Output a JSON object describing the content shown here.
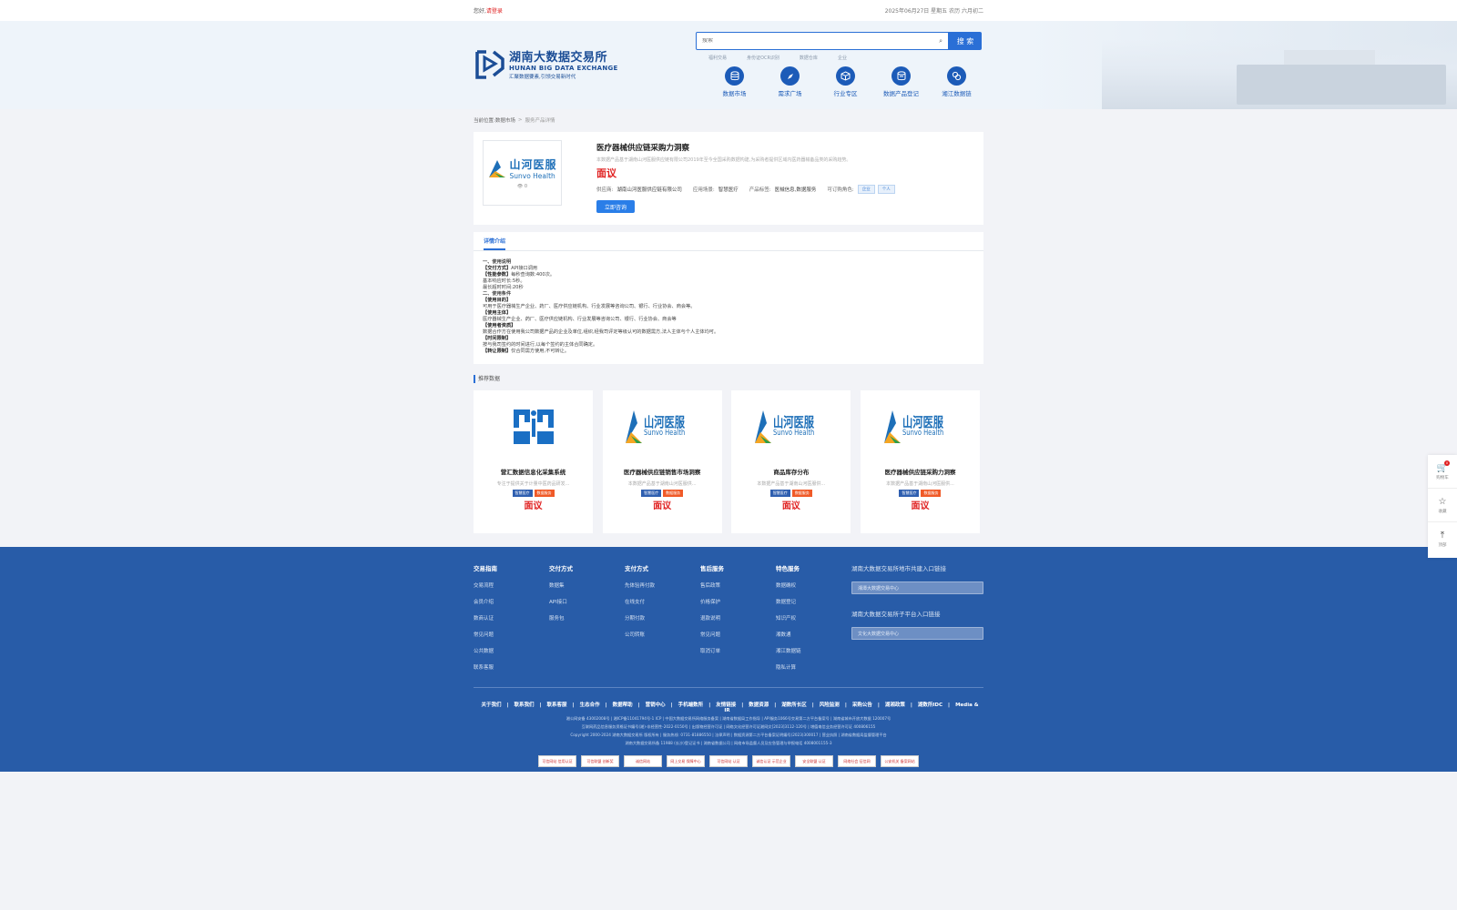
{
  "topbar": {
    "greeting": "您好,",
    "login_link": "请登录",
    "date": "2025年06月27日 星期五 农历 六月初二"
  },
  "header": {
    "logo_cn": "湖南大数据交易所",
    "logo_en": "HUNAN BIG DATA EXCHANGE",
    "logo_slogan": "汇聚数据要素,引领交易新时代",
    "search_placeholder": "搜索",
    "search_button": "搜 索",
    "hot_words": [
      "福利交易",
      "身份证OCR识别",
      "数据仓库",
      "企业"
    ],
    "nav": [
      {
        "label": "数据市场",
        "icon": "database-icon"
      },
      {
        "label": "需求广场",
        "icon": "compass-icon"
      },
      {
        "label": "行业专区",
        "icon": "cube-icon"
      },
      {
        "label": "数据产品登记",
        "icon": "register-icon"
      },
      {
        "label": "湘江数据链",
        "icon": "link-icon"
      }
    ]
  },
  "breadcrumb": {
    "prefix": "当前位置:",
    "level1": "数据市场",
    "sep": ">",
    "current": "服务产品详情"
  },
  "product": {
    "logo_cn": "山河医服",
    "logo_en": "Sunvo Health",
    "view_count": "0",
    "title": "医疗器械供应链采购力洞察",
    "desc": "本数据产品基于湖南山河医服供应链有限公司2019年至今全国采购数据构建,为采购者提供区域内医药器械备品类的采购趋势。",
    "price": "面议",
    "supplier_label": "供应商:",
    "supplier": "湖南山河医服供应链有限公司",
    "scene_label": "应用场景:",
    "scene": "智慧医疗",
    "tag_label": "产品标签:",
    "tag": "医械信息,数据服务",
    "role_label": "可订购角色:",
    "roles": [
      "企业",
      "个人"
    ],
    "consult_button": "立即咨询"
  },
  "detail": {
    "tab": "详情介绍",
    "lines": [
      {
        "b": "",
        "t": "一、使用说明"
      },
      {
        "b": "【交付方式】",
        "t": "API接口调用"
      },
      {
        "b": "【性能参数】",
        "t": "每秒查询数:400次。"
      },
      {
        "b": "",
        "t": "基本响应时长:5秒。"
      },
      {
        "b": "",
        "t": "最长超时时间:20秒"
      },
      {
        "b": "",
        "t": "二、使用条件"
      },
      {
        "b": "【使用目的】",
        "t": ""
      },
      {
        "b": "",
        "t": "可用于医疗器械生产企业、药厂、医疗供应链机构、行业发展等咨询公司、银行、行业协会、商会等。"
      },
      {
        "b": "【使用主体】",
        "t": ""
      },
      {
        "b": "",
        "t": "医疗器械生产企业、药厂、医疗供应链机构、行业发展等咨询公司、银行、行业协会、商会等"
      },
      {
        "b": "【使用者资质】",
        "t": ""
      },
      {
        "b": "",
        "t": "数据合作方在使用我公司数据产品的企业及单位,组织,经我司评定等级认可的数据需方,法人主体与个人主体均可。"
      },
      {
        "b": "【时间限制】",
        "t": ""
      },
      {
        "b": "",
        "t": "按与我司签约的时间进行,以每个签约的主体合同确定。"
      },
      {
        "b": "【转让限制】",
        "t": "仅合同需方使用,不可转让。"
      }
    ]
  },
  "recommend": {
    "title": "推荐数据",
    "items": [
      {
        "name": "营汇数据信息化采集系统",
        "desc": "专注于提供关于计量中医药品研发...",
        "tag1": "智慧医疗",
        "tag2": "数据服务",
        "price": "面议",
        "logo": "yinghui"
      },
      {
        "name": "医疗器械供应链销售市场洞察",
        "desc": "本数据产品基于湖南山河医服供...",
        "tag1": "智慧医疗",
        "tag2": "数据服务",
        "price": "面议",
        "logo": "sunvo"
      },
      {
        "name": "商品库存分布",
        "desc": "本数据产品基于湖南山河医服供...",
        "tag1": "智慧医疗",
        "tag2": "数据服务",
        "price": "面议",
        "logo": "sunvo"
      },
      {
        "name": "医疗器械供应链采购力洞察",
        "desc": "本数据产品基于湖南山河医服供...",
        "tag1": "智慧医疗",
        "tag2": "数据服务",
        "price": "面议",
        "logo": "sunvo"
      }
    ]
  },
  "footer": {
    "cols": [
      {
        "h": "交易指南",
        "items": [
          "交易流程",
          "会员介绍",
          "数商认证",
          "常见问题",
          "公共数据",
          "联系客服"
        ]
      },
      {
        "h": "交付方式",
        "items": [
          "数据集",
          "API接口",
          "服务包"
        ]
      },
      {
        "h": "支付方式",
        "items": [
          "先体验再付款",
          "在线支付",
          "分期付款",
          "公司转账"
        ]
      },
      {
        "h": "售后服务",
        "items": [
          "售后政策",
          "价格保护",
          "退款说明",
          "常见问题",
          "取消订单"
        ]
      },
      {
        "h": "特色服务",
        "items": [
          "数据确权",
          "数据登记",
          "知识产权",
          "湘数通",
          "湘江数据链",
          "隐私计算"
        ]
      }
    ],
    "entry1_label": "湖南大数据交易所地市共建入口链接",
    "entry1_select": "湘潭大数据交易中心",
    "entry2_label": "湖南大数据交易所子平台入口链接",
    "entry2_select": "文化大数据交易中心",
    "links": [
      "关于我们",
      "联系我们",
      "联系客服",
      "生态合作",
      "数据帮助",
      "营销中心",
      "手机端数所",
      "友情链接",
      "数据资源",
      "湖数所长区",
      "风险监测",
      "采购公告",
      "湖湘政策",
      "湖数所IDC",
      "Media & IR"
    ],
    "small1": "湘公网安备 43002008号 | 湘ICP备11041794号-1 ICP | 中国大数据交易所网络服务备案 | 湖南省数据局工作指导 | API服务1066号交易第二方平台备案号 | 湖南省城市开放大数据 120007号",
    "small2": "互联网药品信息服务资格证书编号(湘)-非经营性-2022-0150号 | 出版物经营许可证 | 网络文化经营许可证湘网文[2023]3112-120号 | 增值电信业务经营许可证 400806155",
    "small3": "Copyright 2000-2024 湖南大数据交易所 版权所有 | 服务热线: 0731-81886550 | 法律声明 | 数据资源第二方平台备案证明编号(2023)300017 | 营业执照 | 湖南省数据局监督管理平台",
    "small4": "湖南大数据交易所备 11988 (长沙)登记证书 | 湖南省数据公司 | 网络市场监督人员及应急管理与举报电话 4008001155-3",
    "badges": [
      "可信网站 信用认证",
      "可信联盟 创新奖",
      "诚信网站",
      "网上交易 保障中心",
      "可信网站 认证",
      "诚信认证 示范企业",
      "安全联盟 认证",
      "网络社会 征信网",
      "公安机关 备案网站"
    ]
  },
  "float": [
    {
      "label": "购物车",
      "icon": "cart-icon",
      "badge": "0"
    },
    {
      "label": "收藏",
      "icon": "star-icon"
    },
    {
      "label": "顶部",
      "icon": "top-icon"
    }
  ]
}
